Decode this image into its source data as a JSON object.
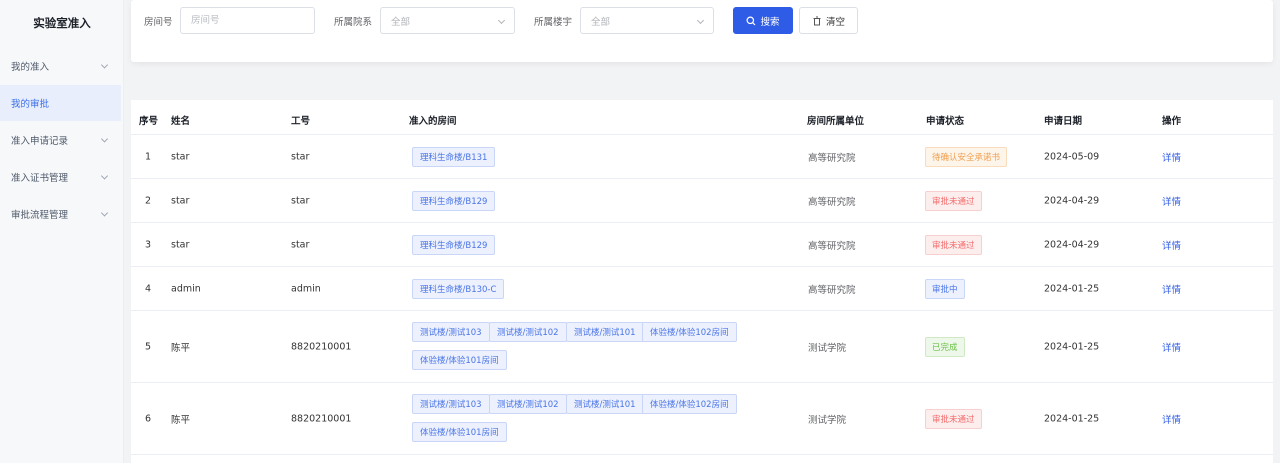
{
  "sidebar": {
    "title": "实验室准入",
    "items": [
      {
        "label": "我的准入",
        "active": false,
        "has_children": true
      },
      {
        "label": "我的审批",
        "active": true,
        "has_children": false
      },
      {
        "label": "准入申请记录",
        "active": false,
        "has_children": true
      },
      {
        "label": "准入证书管理",
        "active": false,
        "has_children": true
      },
      {
        "label": "审批流程管理",
        "active": false,
        "has_children": true
      }
    ]
  },
  "filter": {
    "room_label": "房间号",
    "room_placeholder": "房间号",
    "dept_label": "所属院系",
    "dept_value": "全部",
    "building_label": "所属楼宇",
    "building_value": "全部",
    "search_label": "搜索",
    "clear_label": "清空"
  },
  "table": {
    "columns": [
      "序号",
      "姓名",
      "工号",
      "准入的房间",
      "房间所属单位",
      "申请状态",
      "申请日期",
      "操作"
    ],
    "rows": [
      {
        "no": "1",
        "name": "star",
        "id": "star",
        "rooms": [
          "理科生命楼/B131"
        ],
        "unit": "高等研究院",
        "status": "待确认安全承诺书",
        "status_type": "warning",
        "date": "2024-05-09",
        "action": "详情"
      },
      {
        "no": "2",
        "name": "star",
        "id": "star",
        "rooms": [
          "理科生命楼/B129"
        ],
        "unit": "高等研究院",
        "status": "审批未通过",
        "status_type": "danger",
        "date": "2024-04-29",
        "action": "详情"
      },
      {
        "no": "3",
        "name": "star",
        "id": "star",
        "rooms": [
          "理科生命楼/B129"
        ],
        "unit": "高等研究院",
        "status": "审批未通过",
        "status_type": "danger",
        "date": "2024-04-29",
        "action": "详情"
      },
      {
        "no": "4",
        "name": "admin",
        "id": "admin",
        "rooms": [
          "理科生命楼/B130-C"
        ],
        "unit": "高等研究院",
        "status": "审批中",
        "status_type": "info",
        "date": "2024-01-25",
        "action": "详情"
      },
      {
        "no": "5",
        "name": "陈平",
        "id": "8820210001",
        "rooms": [
          "测试楼/测试103",
          "测试楼/测试102",
          "测试楼/测试101",
          "体验楼/体验102房间",
          "体验楼/体验101房间"
        ],
        "unit": "测试学院",
        "status": "已完成",
        "status_type": "success",
        "date": "2024-01-25",
        "action": "详情"
      },
      {
        "no": "6",
        "name": "陈平",
        "id": "8820210001",
        "rooms": [
          "测试楼/测试103",
          "测试楼/测试102",
          "测试楼/测试101",
          "体验楼/体验102房间",
          "体验楼/体验101房间"
        ],
        "unit": "测试学院",
        "status": "审批未通过",
        "status_type": "danger",
        "date": "2024-01-25",
        "action": "详情"
      }
    ]
  },
  "colors": {
    "primary": "#2f5ce6",
    "warning": "#f0a050",
    "danger": "#f26b6b",
    "info": "#4a74e8",
    "success": "#6cc04a"
  }
}
